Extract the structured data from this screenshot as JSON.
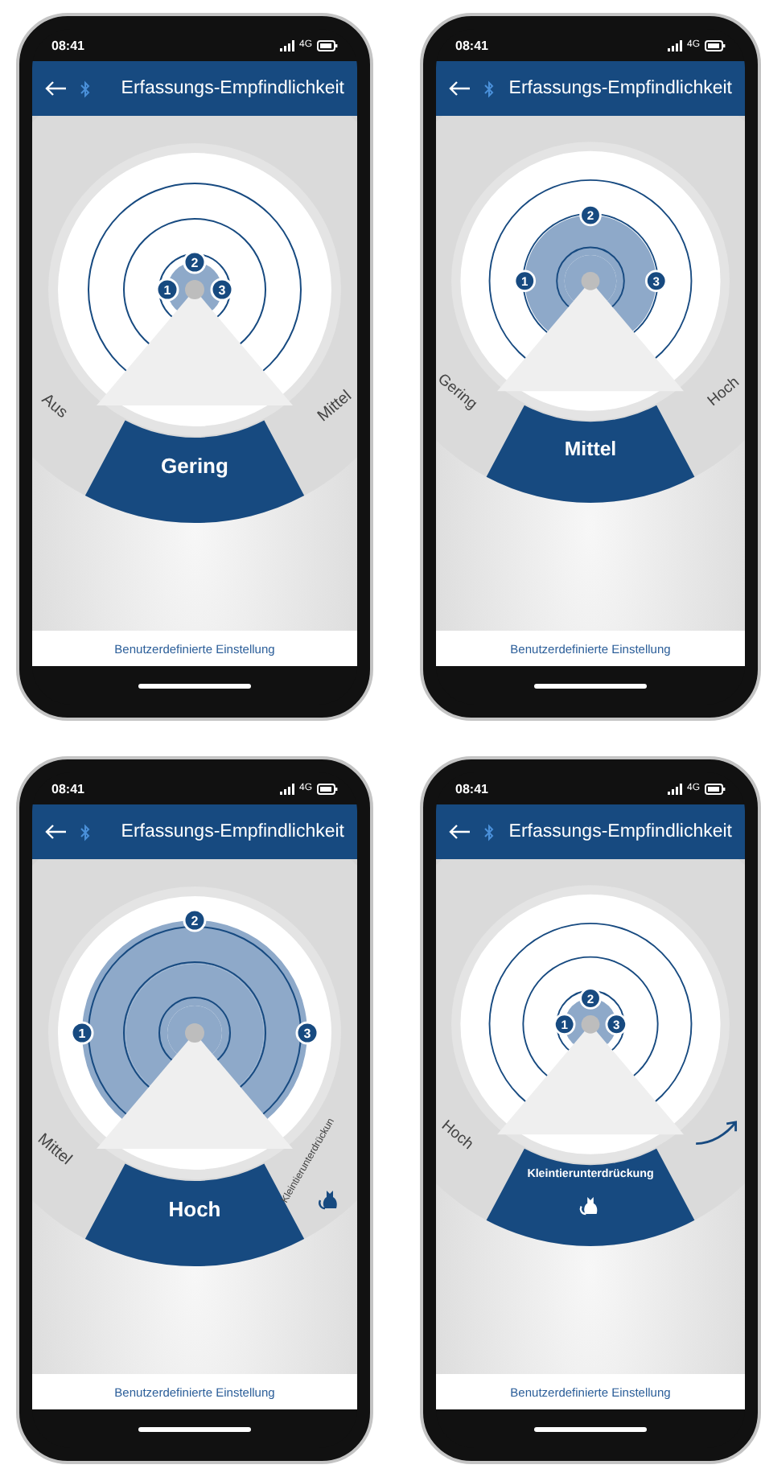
{
  "screens": [
    {
      "status_bar": {
        "time": "08:41",
        "network": "4G"
      },
      "title": "Erfassungs-Empfindlichkeit",
      "zone_rings": [
        {
          "filled": true
        },
        {
          "filled": false
        },
        {
          "filled": false
        }
      ],
      "markers": [
        "1",
        "2",
        "3"
      ],
      "dial": {
        "left": {
          "kind": "text",
          "label": "Aus"
        },
        "selected": {
          "kind": "text",
          "label": "Gering"
        },
        "right": {
          "kind": "text",
          "label": "Mittel"
        }
      },
      "footer_link": "Benutzerdefinierte Einstellung"
    },
    {
      "status_bar": {
        "time": "08:41",
        "network": "4G"
      },
      "title": "Erfassungs-Empfindlichkeit",
      "zone_rings": [
        {
          "filled": true
        },
        {
          "filled": true
        },
        {
          "filled": false
        }
      ],
      "markers": [
        "1",
        "2",
        "3"
      ],
      "dial": {
        "left": {
          "kind": "text",
          "label": "Gering"
        },
        "selected": {
          "kind": "text",
          "label": "Mittel"
        },
        "right": {
          "kind": "text",
          "label": "Hoch"
        }
      },
      "footer_link": "Benutzerdefinierte Einstellung"
    },
    {
      "status_bar": {
        "time": "08:41",
        "network": "4G"
      },
      "title": "Erfassungs-Empfindlichkeit",
      "zone_rings": [
        {
          "filled": true
        },
        {
          "filled": true
        },
        {
          "filled": true
        }
      ],
      "markers": [
        "1",
        "2",
        "3"
      ],
      "dial": {
        "left": {
          "kind": "text",
          "label": "Mittel"
        },
        "selected": {
          "kind": "text",
          "label": "Hoch"
        },
        "right": {
          "kind": "pet",
          "label": "Kleintierunterdrückun"
        }
      },
      "footer_link": "Benutzerdefinierte Einstellung"
    },
    {
      "status_bar": {
        "time": "08:41",
        "network": "4G"
      },
      "title": "Erfassungs-Empfindlichkeit",
      "zone_rings": [
        {
          "filled": true
        },
        {
          "filled": false
        },
        {
          "filled": false
        }
      ],
      "markers": [
        "1",
        "2",
        "3"
      ],
      "dial": {
        "left": {
          "kind": "text",
          "label": "Hoch"
        },
        "selected": {
          "kind": "pet",
          "label": "Kleintierunterdrückung"
        },
        "right": {
          "kind": "arrow"
        }
      },
      "footer_link": "Benutzerdefinierte Einstellung"
    }
  ]
}
